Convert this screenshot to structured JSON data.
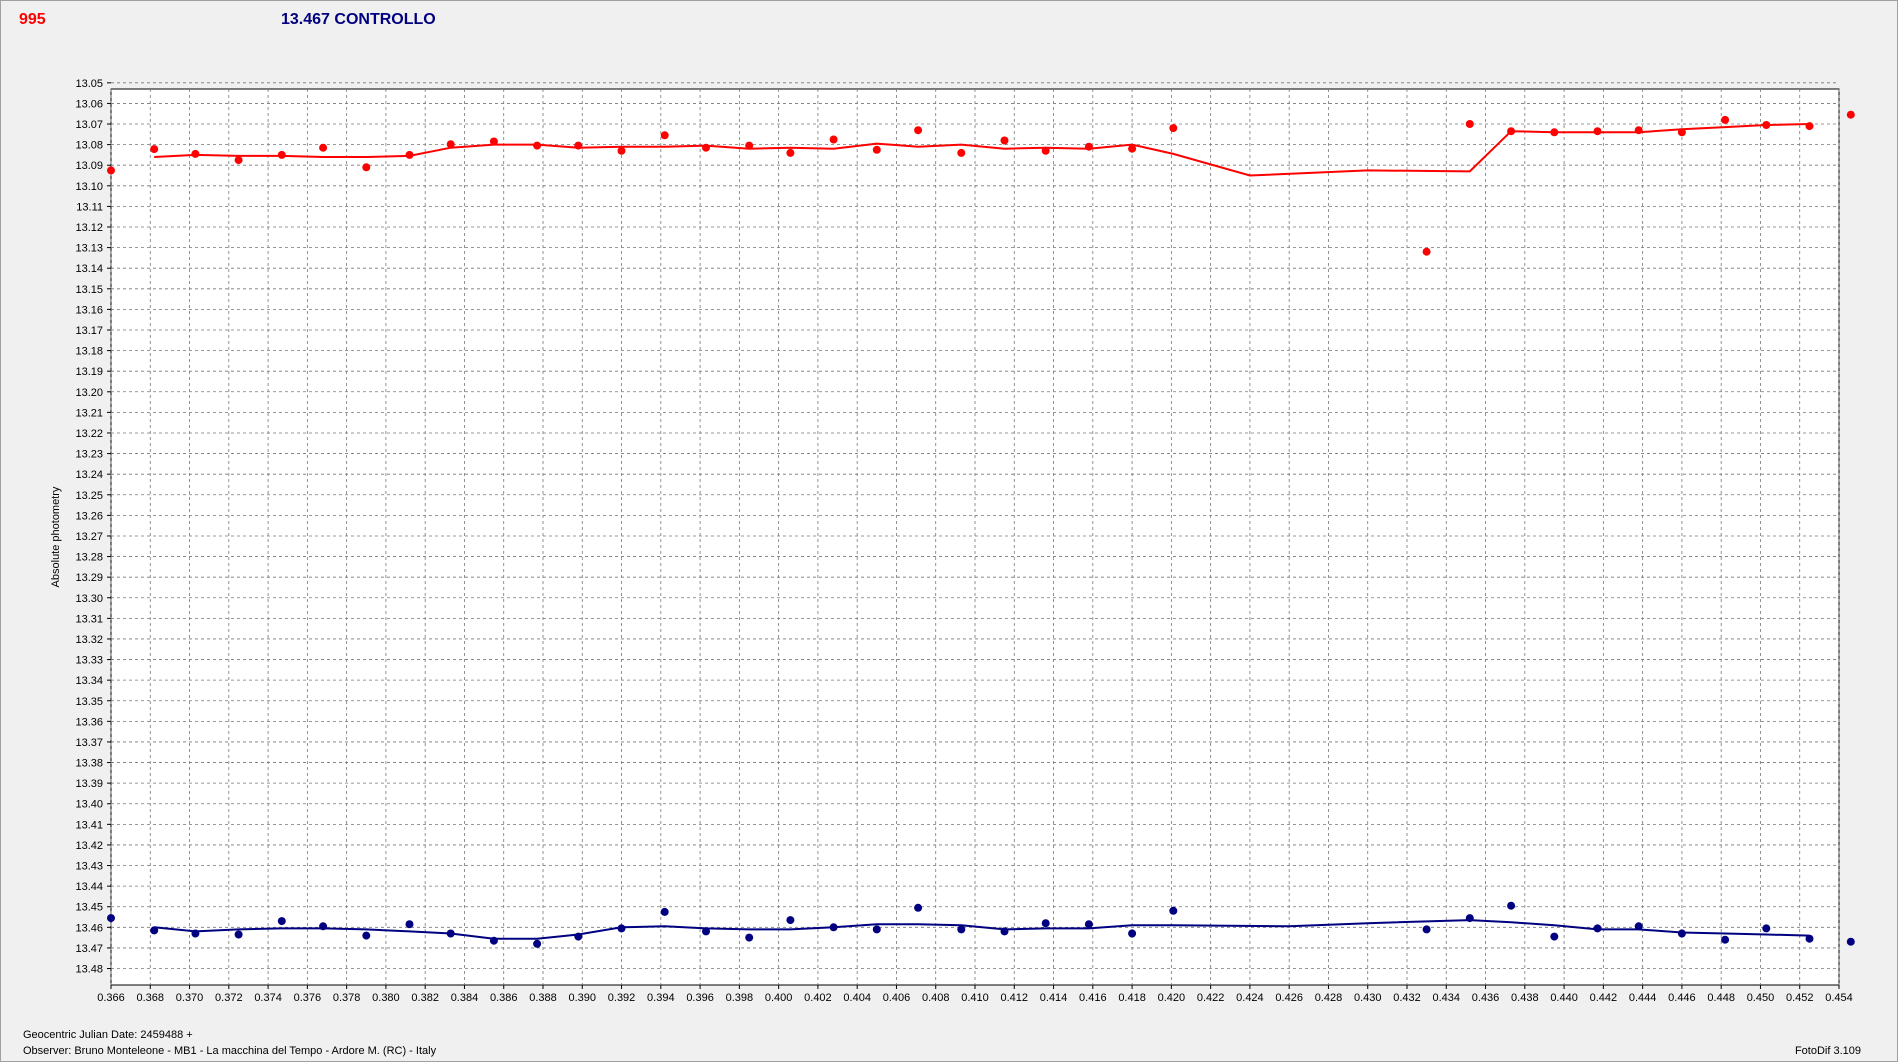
{
  "header": {
    "target_id": "995",
    "comparison_label": "13.467 CONTROLLO"
  },
  "footer": {
    "jd_label": "Geocentric Julian Date: 2459488 +",
    "observer": "Observer: Bruno Monteleone - MB1 - La macchina del Tempo - Ardore M. (RC) - Italy",
    "software": "FotoDif 3.109"
  },
  "chart_data": {
    "type": "scatter",
    "ylabel": "Absolute photometry",
    "xlabel": "",
    "xlim": [
      0.366,
      0.454
    ],
    "ylim": [
      13.053,
      13.488
    ],
    "y_inverted": true,
    "grid": true,
    "x_ticks": [
      0.366,
      0.368,
      0.37,
      0.372,
      0.374,
      0.376,
      0.378,
      0.38,
      0.382,
      0.384,
      0.386,
      0.388,
      0.39,
      0.392,
      0.394,
      0.396,
      0.398,
      0.4,
      0.402,
      0.404,
      0.406,
      0.408,
      0.41,
      0.412,
      0.414,
      0.416,
      0.418,
      0.42,
      0.422,
      0.424,
      0.426,
      0.428,
      0.43,
      0.432,
      0.434,
      0.436,
      0.438,
      0.44,
      0.442,
      0.444,
      0.446,
      0.448,
      0.45,
      0.452,
      0.454
    ],
    "x_tick_labels": [
      "0.366",
      "0.368",
      "0.370",
      "0.372",
      "0.374",
      "0.376",
      "0.378",
      "0.380",
      "0.382",
      "0.384",
      "0.386",
      "0.388",
      "0.390",
      "0.392",
      "0.394",
      "0.396",
      "0.398",
      "0.400",
      "0.402",
      "0.404",
      "0.406",
      "0.408",
      "0.410",
      "0.412",
      "0.414",
      "0.416",
      "0.418",
      "0.420",
      "0.422",
      "0.424",
      "0.426",
      "0.428",
      "0.430",
      "0.432",
      "0.434",
      "0.436",
      "0.438",
      "0.440",
      "0.442",
      "0.444",
      "0.446",
      "0.448",
      "0.450",
      "0.452",
      "0.454"
    ],
    "y_ticks": [
      13.05,
      13.06,
      13.07,
      13.08,
      13.09,
      13.1,
      13.11,
      13.12,
      13.13,
      13.14,
      13.15,
      13.16,
      13.17,
      13.18,
      13.19,
      13.2,
      13.21,
      13.22,
      13.23,
      13.24,
      13.25,
      13.26,
      13.27,
      13.28,
      13.29,
      13.3,
      13.31,
      13.32,
      13.33,
      13.34,
      13.35,
      13.36,
      13.37,
      13.38,
      13.39,
      13.4,
      13.41,
      13.42,
      13.43,
      13.44,
      13.45,
      13.46,
      13.47,
      13.48
    ],
    "y_tick_labels": [
      "13.05",
      "13.06",
      "13.07",
      "13.08",
      "13.09",
      "13.10",
      "13.11",
      "13.12",
      "13.13",
      "13.14",
      "13.15",
      "13.16",
      "13.17",
      "13.18",
      "13.19",
      "13.20",
      "13.21",
      "13.22",
      "13.23",
      "13.24",
      "13.25",
      "13.26",
      "13.27",
      "13.28",
      "13.29",
      "13.30",
      "13.31",
      "13.32",
      "13.33",
      "13.34",
      "13.35",
      "13.36",
      "13.37",
      "13.38",
      "13.39",
      "13.40",
      "13.41",
      "13.42",
      "13.43",
      "13.44",
      "13.45",
      "13.46",
      "13.47",
      "13.48"
    ],
    "series": [
      {
        "color": "#ff0000",
        "points": [
          [
            0.366,
            13.0925
          ],
          [
            0.3682,
            13.0822
          ],
          [
            0.3703,
            13.0845
          ],
          [
            0.3725,
            13.0875
          ],
          [
            0.3747,
            13.085
          ],
          [
            0.3768,
            13.0815
          ],
          [
            0.379,
            13.091
          ],
          [
            0.3812,
            13.085
          ],
          [
            0.3833,
            13.0798
          ],
          [
            0.3855,
            13.0785
          ],
          [
            0.3877,
            13.0805
          ],
          [
            0.3898,
            13.0805
          ],
          [
            0.392,
            13.083
          ],
          [
            0.3942,
            13.0755
          ],
          [
            0.3963,
            13.0815
          ],
          [
            0.3985,
            13.0805
          ],
          [
            0.4006,
            13.084
          ],
          [
            0.4028,
            13.0775
          ],
          [
            0.405,
            13.0825
          ],
          [
            0.4071,
            13.073
          ],
          [
            0.4093,
            13.084
          ],
          [
            0.4115,
            13.078
          ],
          [
            0.4136,
            13.083
          ],
          [
            0.4158,
            13.081
          ],
          [
            0.418,
            13.082
          ],
          [
            0.4201,
            13.072
          ],
          [
            0.433,
            13.132
          ],
          [
            0.4352,
            13.07
          ],
          [
            0.4373,
            13.0735
          ],
          [
            0.4395,
            13.074
          ],
          [
            0.4417,
            13.0735
          ],
          [
            0.4438,
            13.073
          ],
          [
            0.446,
            13.074
          ],
          [
            0.4482,
            13.068
          ],
          [
            0.4503,
            13.0705
          ],
          [
            0.4525,
            13.071
          ],
          [
            0.4546,
            13.0655
          ]
        ],
        "trend": [
          [
            0.3682,
            13.086
          ],
          [
            0.3703,
            13.085
          ],
          [
            0.3725,
            13.0855
          ],
          [
            0.3747,
            13.0855
          ],
          [
            0.3768,
            13.086
          ],
          [
            0.379,
            13.086
          ],
          [
            0.3812,
            13.0855
          ],
          [
            0.3833,
            13.0815
          ],
          [
            0.3855,
            13.08
          ],
          [
            0.3877,
            13.08
          ],
          [
            0.3898,
            13.0815
          ],
          [
            0.392,
            13.081
          ],
          [
            0.3942,
            13.081
          ],
          [
            0.3963,
            13.0805
          ],
          [
            0.3985,
            13.082
          ],
          [
            0.4006,
            13.0815
          ],
          [
            0.4028,
            13.082
          ],
          [
            0.405,
            13.0795
          ],
          [
            0.4071,
            13.081
          ],
          [
            0.4093,
            13.08
          ],
          [
            0.4115,
            13.082
          ],
          [
            0.4136,
            13.0815
          ],
          [
            0.4158,
            13.082
          ],
          [
            0.418,
            13.08
          ],
          [
            0.4201,
            13.0845
          ],
          [
            0.424,
            13.095
          ],
          [
            0.43,
            13.0925
          ],
          [
            0.4352,
            13.093
          ],
          [
            0.4373,
            13.0735
          ],
          [
            0.4395,
            13.074
          ],
          [
            0.4417,
            13.074
          ],
          [
            0.4438,
            13.074
          ],
          [
            0.446,
            13.0725
          ],
          [
            0.4482,
            13.0715
          ],
          [
            0.4503,
            13.0705
          ],
          [
            0.4525,
            13.07
          ]
        ]
      },
      {
        "color": "#000080",
        "points": [
          [
            0.366,
            13.4555
          ],
          [
            0.3682,
            13.4615
          ],
          [
            0.3703,
            13.463
          ],
          [
            0.3725,
            13.4635
          ],
          [
            0.3747,
            13.457
          ],
          [
            0.3768,
            13.4595
          ],
          [
            0.379,
            13.464
          ],
          [
            0.3812,
            13.4585
          ],
          [
            0.3833,
            13.463
          ],
          [
            0.3855,
            13.4665
          ],
          [
            0.3877,
            13.468
          ],
          [
            0.3898,
            13.4645
          ],
          [
            0.392,
            13.4605
          ],
          [
            0.3942,
            13.4525
          ],
          [
            0.3963,
            13.462
          ],
          [
            0.3985,
            13.465
          ],
          [
            0.4006,
            13.4565
          ],
          [
            0.4028,
            13.46
          ],
          [
            0.405,
            13.461
          ],
          [
            0.4071,
            13.4505
          ],
          [
            0.4093,
            13.461
          ],
          [
            0.4115,
            13.462
          ],
          [
            0.4136,
            13.458
          ],
          [
            0.4158,
            13.4585
          ],
          [
            0.418,
            13.463
          ],
          [
            0.4201,
            13.452
          ],
          [
            0.433,
            13.461
          ],
          [
            0.4352,
            13.4555
          ],
          [
            0.4373,
            13.4495
          ],
          [
            0.4395,
            13.4645
          ],
          [
            0.4417,
            13.4605
          ],
          [
            0.4438,
            13.4595
          ],
          [
            0.446,
            13.463
          ],
          [
            0.4482,
            13.466
          ],
          [
            0.4503,
            13.4605
          ],
          [
            0.4525,
            13.4655
          ],
          [
            0.4546,
            13.467
          ]
        ],
        "trend": [
          [
            0.3682,
            13.46
          ],
          [
            0.3703,
            13.462
          ],
          [
            0.3725,
            13.461
          ],
          [
            0.3747,
            13.4605
          ],
          [
            0.3768,
            13.4605
          ],
          [
            0.379,
            13.461
          ],
          [
            0.3812,
            13.462
          ],
          [
            0.3833,
            13.463
          ],
          [
            0.3855,
            13.4655
          ],
          [
            0.3877,
            13.4655
          ],
          [
            0.3898,
            13.4635
          ],
          [
            0.392,
            13.46
          ],
          [
            0.3942,
            13.4595
          ],
          [
            0.3963,
            13.4605
          ],
          [
            0.3985,
            13.461
          ],
          [
            0.4006,
            13.461
          ],
          [
            0.4028,
            13.46
          ],
          [
            0.405,
            13.4585
          ],
          [
            0.4071,
            13.4585
          ],
          [
            0.4093,
            13.459
          ],
          [
            0.4115,
            13.461
          ],
          [
            0.4136,
            13.4605
          ],
          [
            0.4158,
            13.4605
          ],
          [
            0.418,
            13.459
          ],
          [
            0.4201,
            13.459
          ],
          [
            0.426,
            13.4595
          ],
          [
            0.43,
            13.458
          ],
          [
            0.4352,
            13.4565
          ],
          [
            0.4373,
            13.4575
          ],
          [
            0.4395,
            13.459
          ],
          [
            0.4417,
            13.461
          ],
          [
            0.4438,
            13.461
          ],
          [
            0.446,
            13.4625
          ],
          [
            0.4482,
            13.463
          ],
          [
            0.4503,
            13.4635
          ],
          [
            0.4525,
            13.464
          ]
        ]
      }
    ]
  }
}
